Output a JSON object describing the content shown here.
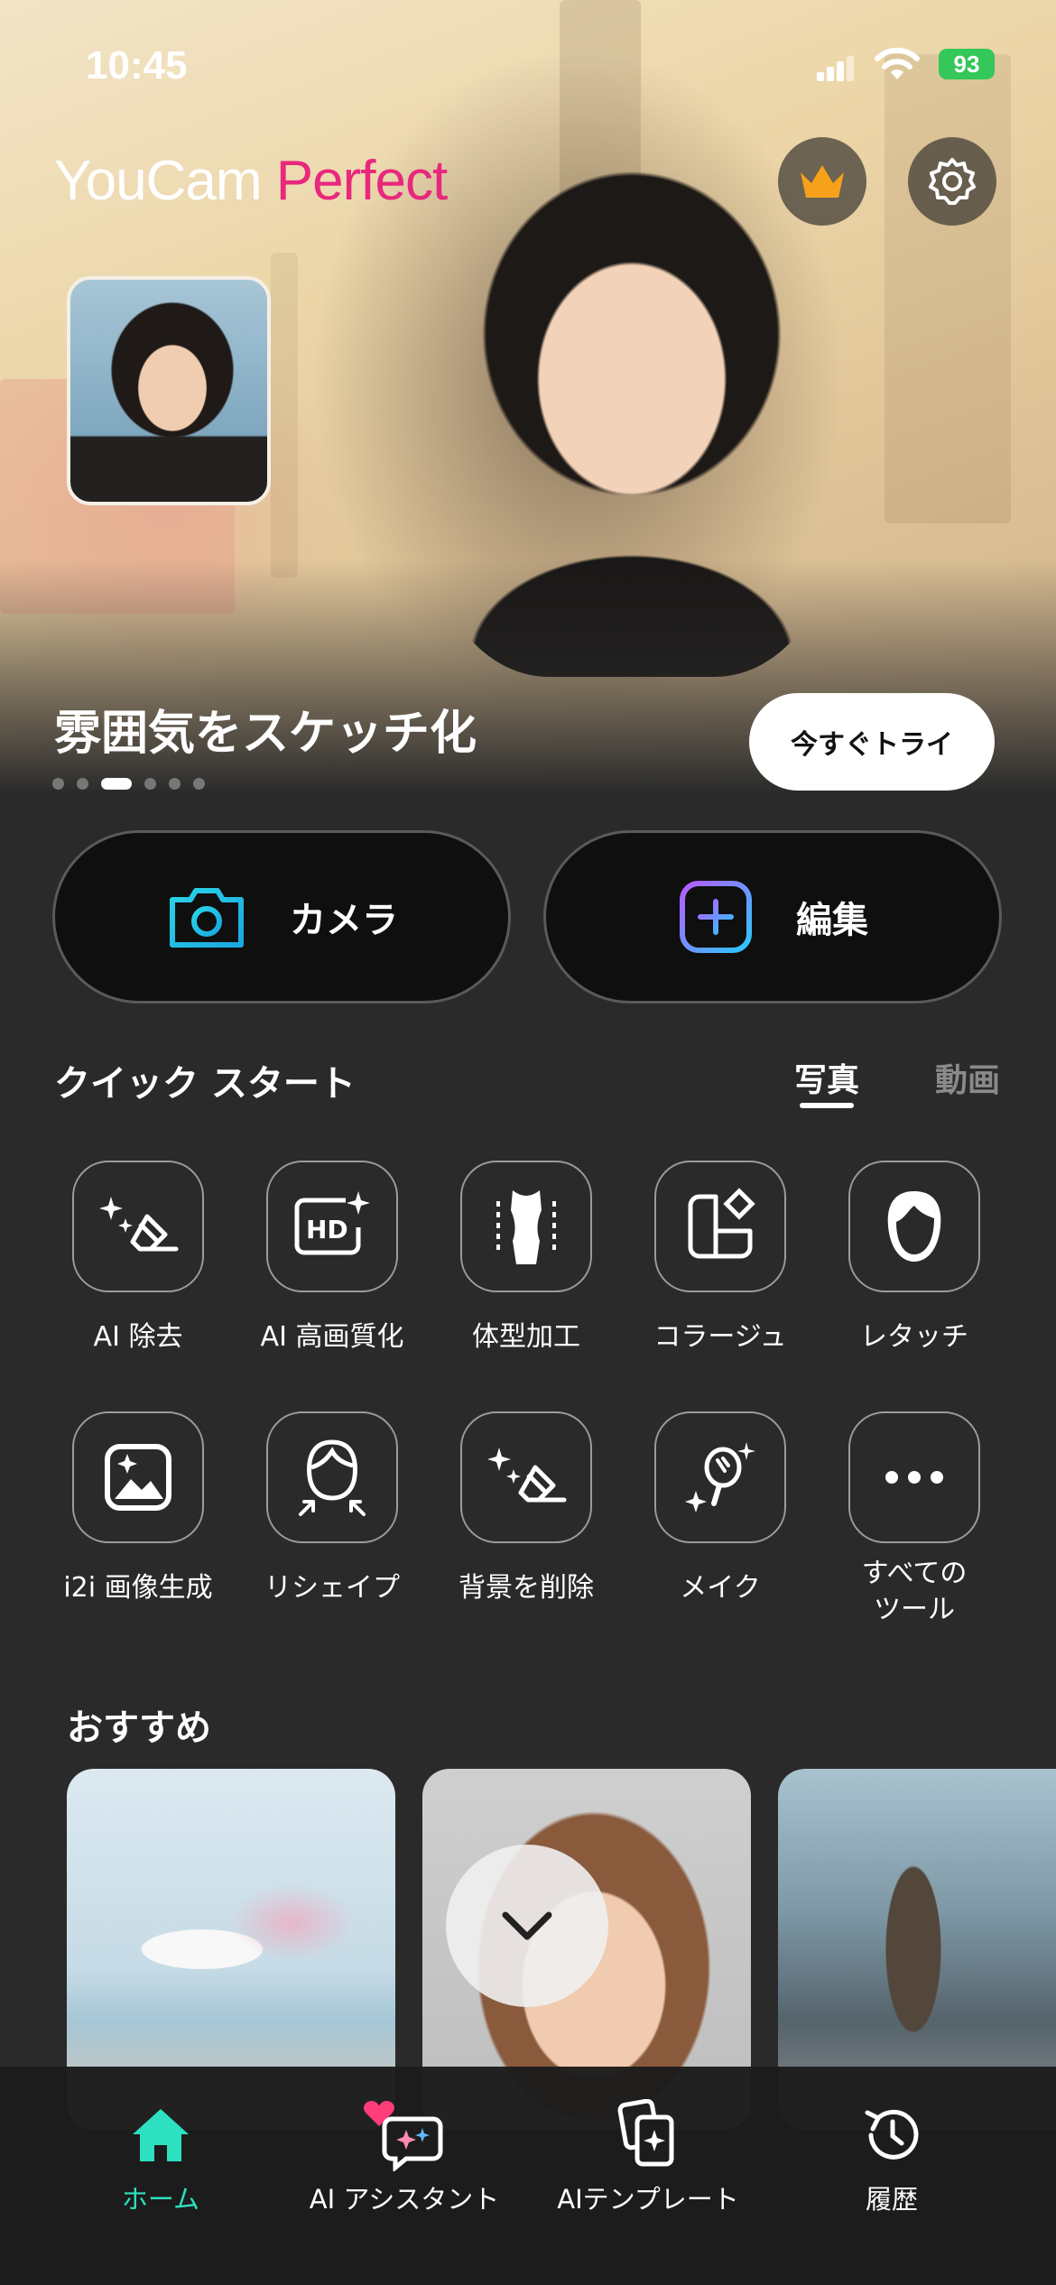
{
  "status_bar": {
    "time": "10:45",
    "battery": "93"
  },
  "header": {
    "logo_part1": "YouCam ",
    "logo_part2": "Perfect"
  },
  "banner": {
    "title": "雰囲気をスケッチ化",
    "try_button": "今すぐトライ",
    "page_count": 6,
    "active_page": 3
  },
  "main_actions": {
    "camera_label": "カメラ",
    "edit_label": "編集"
  },
  "quick_start": {
    "title": "クイック スタート",
    "tabs": [
      {
        "label": "写真",
        "active": true
      },
      {
        "label": "動画",
        "active": false
      }
    ],
    "tools": [
      {
        "label": "AI 除去",
        "icon": "sparkle-eraser-icon"
      },
      {
        "label": "AI 高画質化",
        "icon": "hd-icon"
      },
      {
        "label": "体型加工",
        "icon": "body-shape-icon"
      },
      {
        "label": "コラージュ",
        "icon": "collage-icon"
      },
      {
        "label": "レタッチ",
        "icon": "face-retouch-icon"
      },
      {
        "label": "i2i 画像生成",
        "icon": "image-generate-icon"
      },
      {
        "label": "リシェイプ",
        "icon": "reshape-icon"
      },
      {
        "label": "背景を削除",
        "icon": "background-remove-icon"
      },
      {
        "label": "メイク",
        "icon": "makeup-mirror-icon"
      },
      {
        "label": "すべての\nツール",
        "icon": "more-dots-icon"
      }
    ]
  },
  "recommended": {
    "title": "おすすめ"
  },
  "tab_bar": {
    "items": [
      {
        "label": "ホーム",
        "icon": "home-icon",
        "active": true
      },
      {
        "label": "AI アシスタント",
        "icon": "ai-assistant-icon",
        "active": false
      },
      {
        "label": "AIテンプレート",
        "icon": "ai-template-icon",
        "active": false
      },
      {
        "label": "履歴",
        "icon": "history-icon",
        "active": false
      }
    ]
  },
  "colors": {
    "accent": "#2de0c0",
    "brand": "#e8287d",
    "camera_icon": "#22c3e6",
    "edit_icon": "#7a5cff"
  }
}
